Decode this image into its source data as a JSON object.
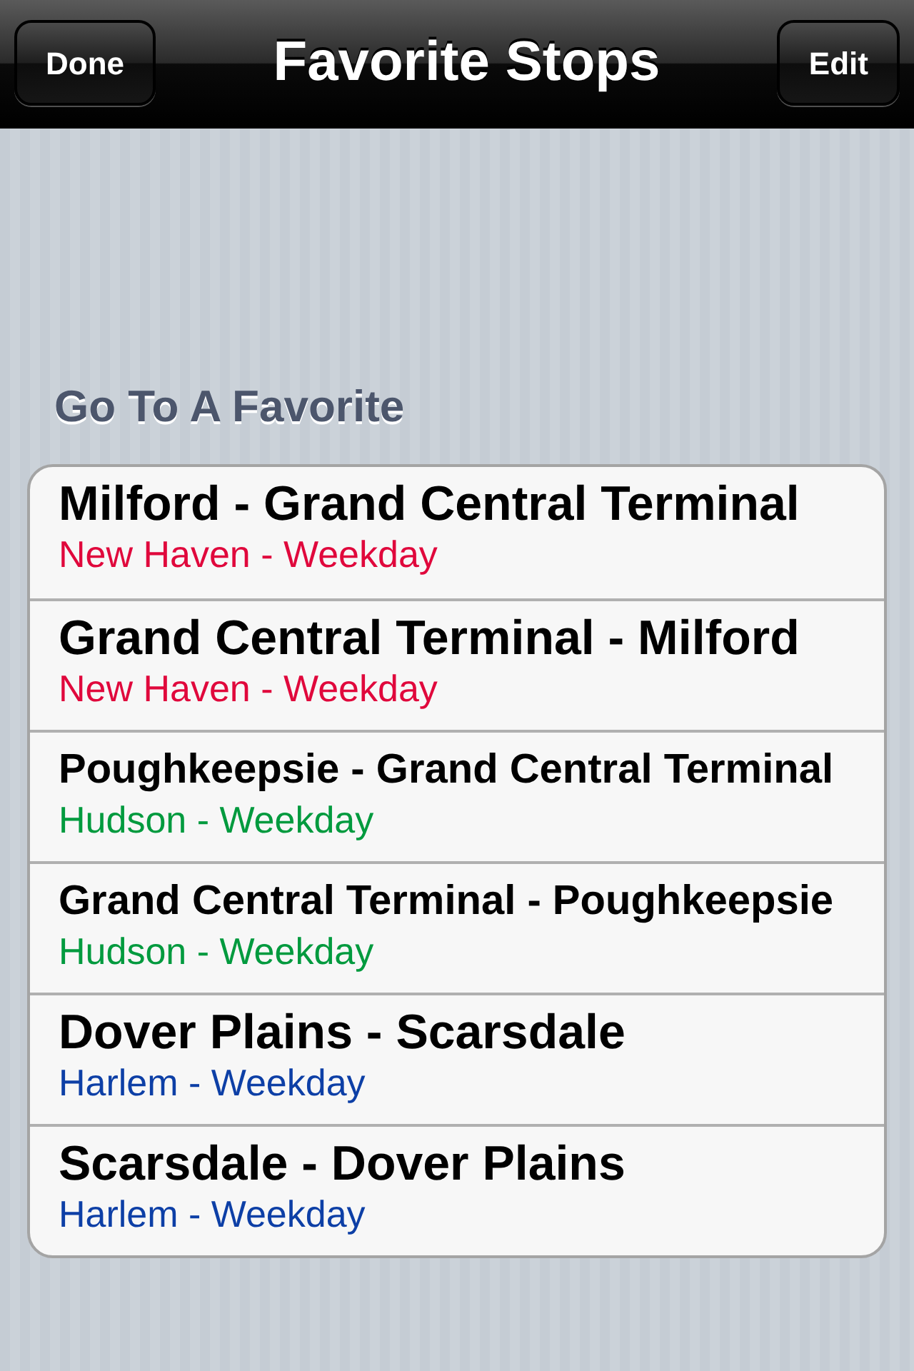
{
  "nav_bar": {
    "title": "Favorite Stops",
    "left_button": "Done",
    "right_button": "Edit"
  },
  "section": {
    "header": "Go To A Favorite",
    "items": [
      {
        "title": "Milford - Grand Central Terminal",
        "line": "New Haven - Weekday",
        "color": "#e0083c"
      },
      {
        "title": "Grand Central Terminal - Milford",
        "line": "New Haven - Weekday",
        "color": "#e0083c"
      },
      {
        "title": "Poughkeepsie - Grand Central Terminal",
        "line": "Hudson - Weekday",
        "color": "#009a3e"
      },
      {
        "title": "Grand Central Terminal - Poughkeepsie",
        "line": "Hudson - Weekday",
        "color": "#009a3e"
      },
      {
        "title": "Dover Plains - Scarsdale",
        "line": "Harlem - Weekday",
        "color": "#0d3fa6"
      },
      {
        "title": "Scarsdale - Dover Plains",
        "line": "Harlem - Weekday",
        "color": "#0d3fa6"
      }
    ]
  }
}
